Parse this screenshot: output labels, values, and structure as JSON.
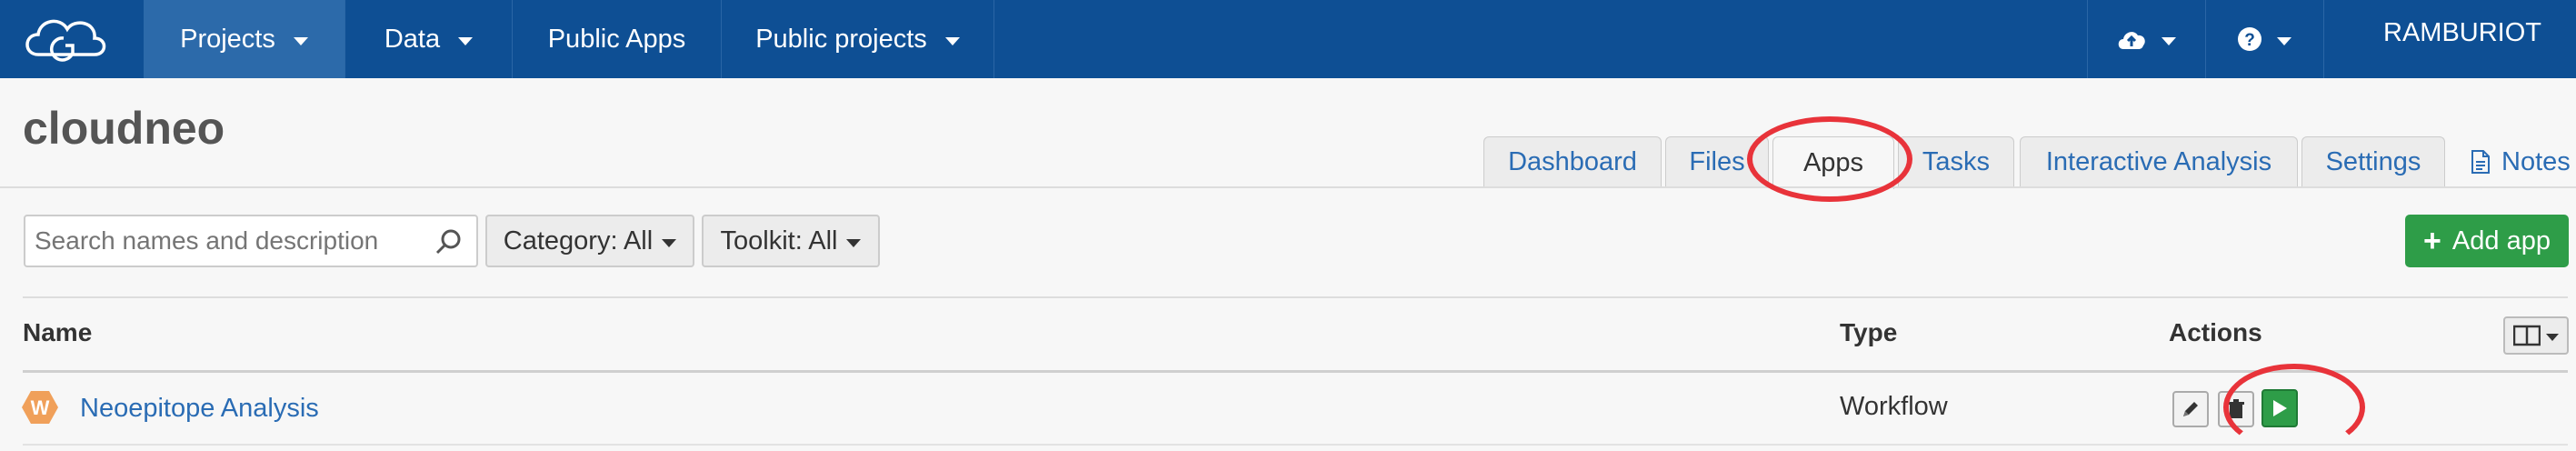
{
  "navbar": {
    "items": [
      {
        "label": "Projects",
        "has_caret": true
      },
      {
        "label": "Data",
        "has_caret": true
      },
      {
        "label": "Public Apps",
        "has_caret": false
      },
      {
        "label": "Public projects",
        "has_caret": true
      }
    ],
    "upload_icon": "cloud-upload-icon",
    "help_icon": "question-circle-icon",
    "user_label": "RAMBURIOT"
  },
  "project": {
    "title": "cloudneo"
  },
  "tabs": [
    {
      "label": "Dashboard"
    },
    {
      "label": "Files"
    },
    {
      "label": "Apps",
      "active": true
    },
    {
      "label": "Tasks"
    },
    {
      "label": "Interactive Analysis"
    },
    {
      "label": "Settings"
    }
  ],
  "notes_label": "Notes",
  "filters": {
    "search_placeholder": "Search names and description",
    "category_label": "Category: All",
    "toolkit_label": "Toolkit: All",
    "add_app_label": "Add app"
  },
  "table": {
    "columns": [
      "Name",
      "Type",
      "Actions"
    ],
    "rows": [
      {
        "badge": "W",
        "name": "Neoepitope Analysis",
        "type": "Workflow"
      }
    ]
  },
  "colors": {
    "navbar": "#0e4f94",
    "link": "#2a6cb4",
    "success": "#2e9d48",
    "annotation": "#e8333a",
    "workflow_badge": "#f0a05a"
  }
}
